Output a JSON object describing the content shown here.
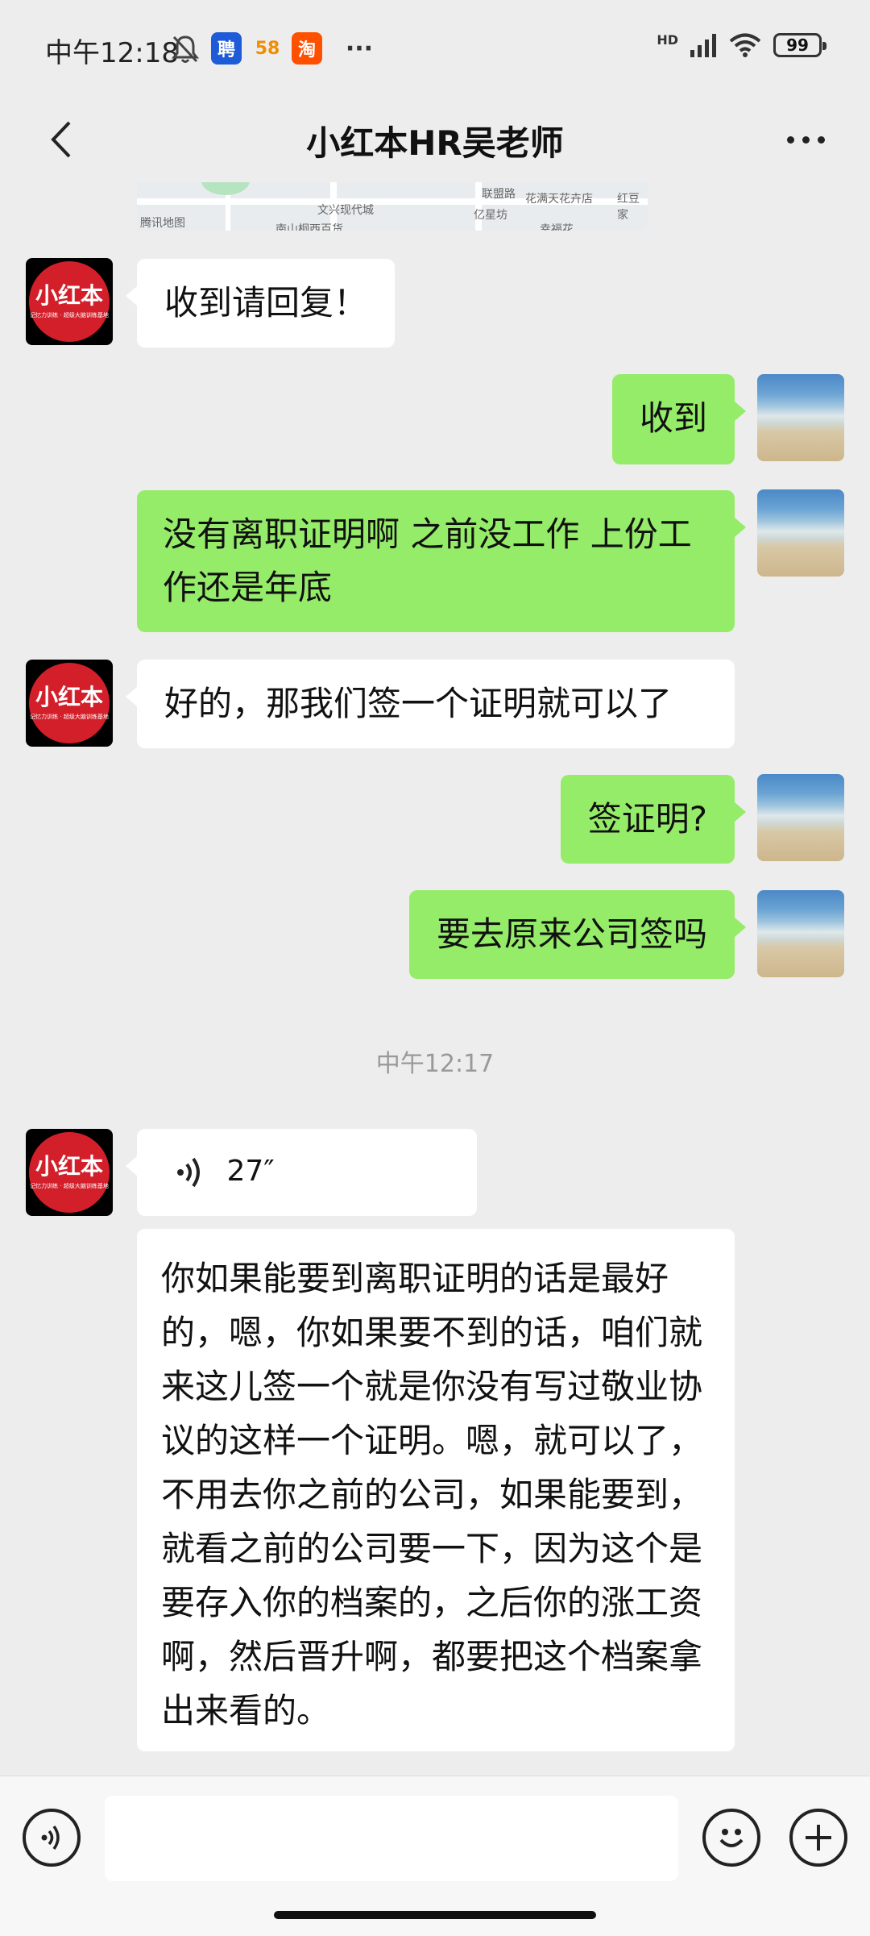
{
  "status_bar": {
    "time": "中午12:18",
    "app_badges": [
      "聘",
      "58",
      "淘"
    ],
    "more": "···",
    "network": "HD",
    "battery": "99"
  },
  "nav": {
    "title": "小红本HR吴老师"
  },
  "map_preview": {
    "labels": [
      "腾讯地图",
      "文兴现代城",
      "花满天花卉店",
      "红豆家",
      "亿星坊",
      "南山桐西百货",
      "幸福花",
      "联盟路"
    ]
  },
  "avatar_text": {
    "big": "小红本",
    "small": "记忆力训练 · 超级大脑训练基地"
  },
  "messages": [
    {
      "side": "left",
      "text": "收到请回复！"
    },
    {
      "side": "right",
      "text": "收到"
    },
    {
      "side": "right",
      "text": "没有离职证明啊 之前没工作 上份工作还是年底"
    },
    {
      "side": "left",
      "text": "好的，那我们签一个证明就可以了"
    },
    {
      "side": "right",
      "text": "签证明?"
    },
    {
      "side": "right",
      "text": "要去原来公司签吗"
    }
  ],
  "timestamp": "中午12:17",
  "voice_message": {
    "duration": "27″",
    "transcript": "你如果能要到离职证明的话是最好的，嗯，你如果要不到的话，咱们就来这儿签一个就是你没有写过敬业协议的这样一个证明。嗯，就可以了，不用去你之前的公司，如果能要到，就看之前的公司要一下，因为这个是要存入你的档案的，之后你的涨工资啊，然后晋升啊，都要把这个档案拿出来看的。"
  },
  "input": {
    "value": "",
    "placeholder": ""
  }
}
